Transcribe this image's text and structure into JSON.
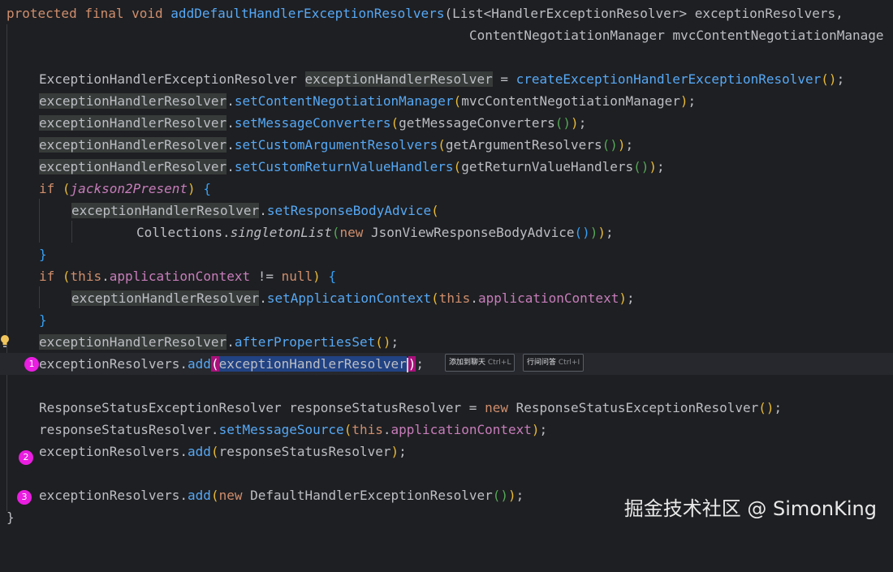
{
  "editor": {
    "language": "java",
    "lines": [
      {
        "line1a": "protected",
        "line1b": "final",
        "line1c": "void",
        "line1d": "addDefaultHandlerExceptionResolvers",
        "line1e": "(List<HandlerExceptionResolver> exceptionResolvers,"
      },
      {
        "line2": "ContentNegotiationManager mvcContentNegotiationManage"
      }
    ],
    "code": {
      "l1_mod": "protected final void ",
      "l1_fn": "addDefaultHandlerExceptionResolvers",
      "l1_rest": "(List<HandlerExceptionResolver> exceptionResolvers,",
      "l2": "ContentNegotiationManager mvcContentNegotiationManage",
      "l4_type": "ExceptionHandlerExceptionResolver ",
      "var": "exceptionHandlerResolver",
      "l4_eq": " = ",
      "l4_fn": "createExceptionHandlerExceptionResolver",
      "l4_tail": "();",
      "l5_fn": "setContentNegotiationManager",
      "l5_arg": "mvcContentNegotiationManager",
      "l6_fn": "setMessageConverters",
      "l6_arg": "getMessageConverters",
      "l7_fn": "setCustomArgumentResolvers",
      "l7_arg": "getArgumentResolvers",
      "l8_fn": "setCustomReturnValueHandlers",
      "l8_arg": "getReturnValueHandlers",
      "if": "if",
      "jackson": "jackson2Present",
      "l10_fn": "setResponseBodyAdvice",
      "collections": "Collections.",
      "singleton": "singletonList",
      "new": "new",
      "jsonview": "JsonViewResponseBodyAdvice",
      "this": "this",
      "appctx": "applicationContext",
      "neq": " != ",
      "null": "null",
      "l14_fn": "setApplicationContext",
      "l16_fn": "afterPropertiesSet",
      "resolvers": "exceptionResolvers.",
      "add": "add",
      "rset_type": "ResponseStatusExceptionResolver ",
      "rs_var": "responseStatusResolver",
      "rs_ctor": "ResponseStatusExceptionResolver",
      "l20_fn": "setMessageSource",
      "default_resolver": "DefaultHandlerExceptionResolver"
    }
  },
  "markers": [
    "1",
    "2",
    "3"
  ],
  "actions": {
    "add_to_chat": "添加到聊天",
    "add_to_chat_shortcut": "Ctrl+L",
    "inline_ask": "行间问答",
    "inline_ask_shortcut": "Ctrl+I"
  },
  "watermark": "掘金技术社区 @ SimonKing",
  "icons": {
    "bulb": "lightbulb-icon"
  },
  "colors": {
    "background": "#1e1f22",
    "keyword": "#cf8e6d",
    "method": "#56a8f5",
    "field": "#c77dbb",
    "marker": "#e91ee0",
    "selection": "#214283"
  }
}
